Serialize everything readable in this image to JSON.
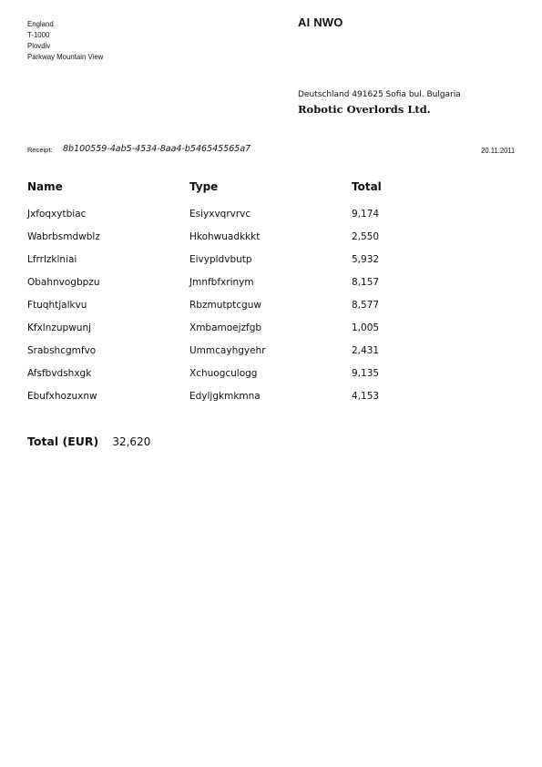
{
  "sender": {
    "lines": [
      "England",
      "T-1000",
      "Plovdiv",
      "Parkway Mountain View"
    ]
  },
  "brand": "AI NWO",
  "recipient": {
    "address": "Deutschland 491625 Sofia bul. Bulgaria",
    "name": "Robotic Overlords Ltd."
  },
  "receipt": {
    "label": "Receipt:",
    "id": "8b100559-4ab5-4534-8aa4-b546545565a7",
    "date": "20.11.2011"
  },
  "table": {
    "headers": [
      "Name",
      "Type",
      "Total"
    ],
    "rows": [
      [
        "Jxfoqxytbiac",
        "Esiyxvqrvrvc",
        "9,174"
      ],
      [
        "Wabrbsmdwblz",
        "Hkohwuadkkkt",
        "2,550"
      ],
      [
        "Lfrrlzklniai",
        "Eivypldvbutp",
        "5,932"
      ],
      [
        "Obahnvogbpzu",
        "Jmnfbfxrinym",
        "8,157"
      ],
      [
        "Ftuqhtjalkvu",
        "Rbzmutptcguw",
        "8,577"
      ],
      [
        "Kfxlnzupwunj",
        "Xmbamoejzfgb",
        "1,005"
      ],
      [
        "Srabshcgmfvo",
        "Ummcayhgyehr",
        "2,431"
      ],
      [
        "Afsfbvdshxgk",
        "Xchuogculogg",
        "9,135"
      ],
      [
        "Ebufxhozuxnw",
        "Edyljgkmkmna",
        "4,153"
      ]
    ]
  },
  "total": {
    "label": "Total (EUR)",
    "amount": "32,620"
  }
}
